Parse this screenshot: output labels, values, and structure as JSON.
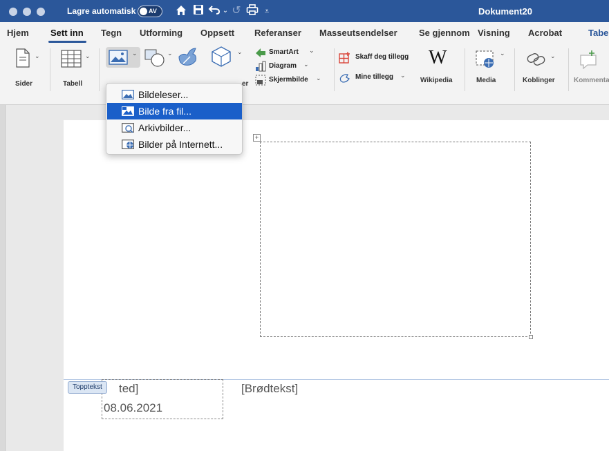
{
  "titlebar": {
    "autosave_label": "Lagre automatisk",
    "autosave_state": "AV",
    "document_title": "Dokument20"
  },
  "tabs": [
    {
      "label": "Hjem"
    },
    {
      "label": "Sett inn",
      "active": true
    },
    {
      "label": "Tegn"
    },
    {
      "label": "Utforming"
    },
    {
      "label": "Oppsett"
    },
    {
      "label": "Referanser"
    },
    {
      "label": "Masseutsendelser"
    },
    {
      "label": "Se gjennom"
    },
    {
      "label": "Visning"
    },
    {
      "label": "Acrobat"
    },
    {
      "label": "Tabe"
    }
  ],
  "ribbon": {
    "sider": "Sider",
    "tabell": "Tabell",
    "partial_label": "er",
    "smartart": "SmartArt",
    "diagram": "Diagram",
    "skjermbilde": "Skjermbilde",
    "skaff_tillegg": "Skaff deg tillegg",
    "mine_tillegg": "Mine tillegg",
    "wikipedia": "Wikipedia",
    "media": "Media",
    "koblinger": "Koblinger",
    "kommentar": "Kommenta"
  },
  "picture_menu": {
    "items": [
      {
        "label": "Bildeleser...",
        "icon": "picture-icon"
      },
      {
        "label": "Bilde fra fil...",
        "icon": "picture-file-icon",
        "selected": true
      },
      {
        "label": "Arkivbilder...",
        "icon": "stock-images-icon"
      },
      {
        "label": "Bilder på Internett...",
        "icon": "online-pictures-icon"
      }
    ]
  },
  "document": {
    "header_tag": "Topptekst",
    "header_text": "ted]",
    "header_date": "08.06.2021",
    "body_placeholder": "[Brødtekst]"
  },
  "colors": {
    "titlebar": "#2b579a",
    "selection": "#1a5fc9",
    "ribbon": "#f3f3f3"
  }
}
